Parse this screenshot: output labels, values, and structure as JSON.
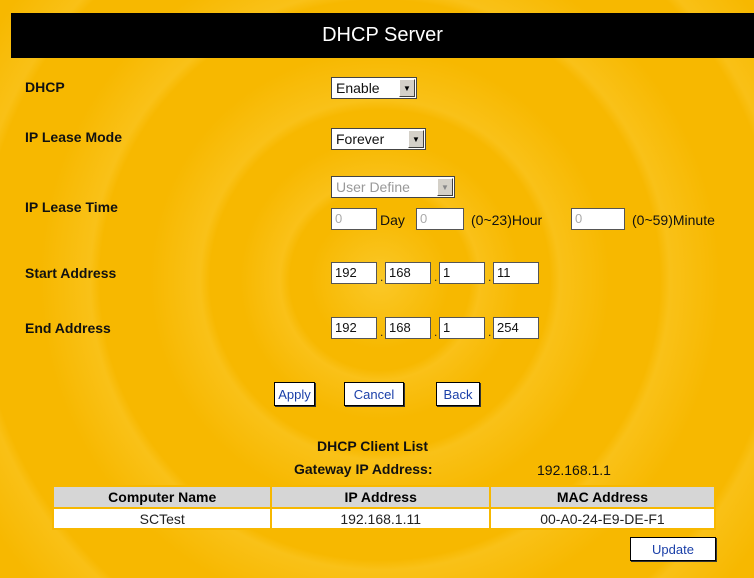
{
  "page": {
    "title": "DHCP Server"
  },
  "fields": {
    "dhcp": {
      "label": "DHCP",
      "value": "Enable"
    },
    "lease_mode": {
      "label": "IP Lease Mode",
      "value": "Forever"
    },
    "lease_time": {
      "label": "IP Lease Time",
      "select_value": "User Define",
      "day_value": "0",
      "day_label": "Day",
      "hour_value": "0",
      "hour_label": "(0~23)Hour",
      "minute_value": "0",
      "minute_label": "(0~59)Minute"
    },
    "start_address": {
      "label": "Start Address",
      "octets": [
        "192",
        "168",
        "1",
        "11"
      ]
    },
    "end_address": {
      "label": "End Address",
      "octets": [
        "192",
        "168",
        "1",
        "254"
      ]
    }
  },
  "buttons": {
    "apply": "Apply",
    "cancel": "Cancel",
    "back": "Back",
    "update": "Update"
  },
  "client_list": {
    "title": "DHCP Client List",
    "gateway_label": "Gateway IP Address:",
    "gateway_value": "192.168.1.1",
    "headers": [
      "Computer Name",
      "IP Address",
      "MAC Address"
    ],
    "rows": [
      [
        "SCTest",
        "192.168.1.11",
        "00-A0-24-E9-DE-F1"
      ]
    ]
  }
}
